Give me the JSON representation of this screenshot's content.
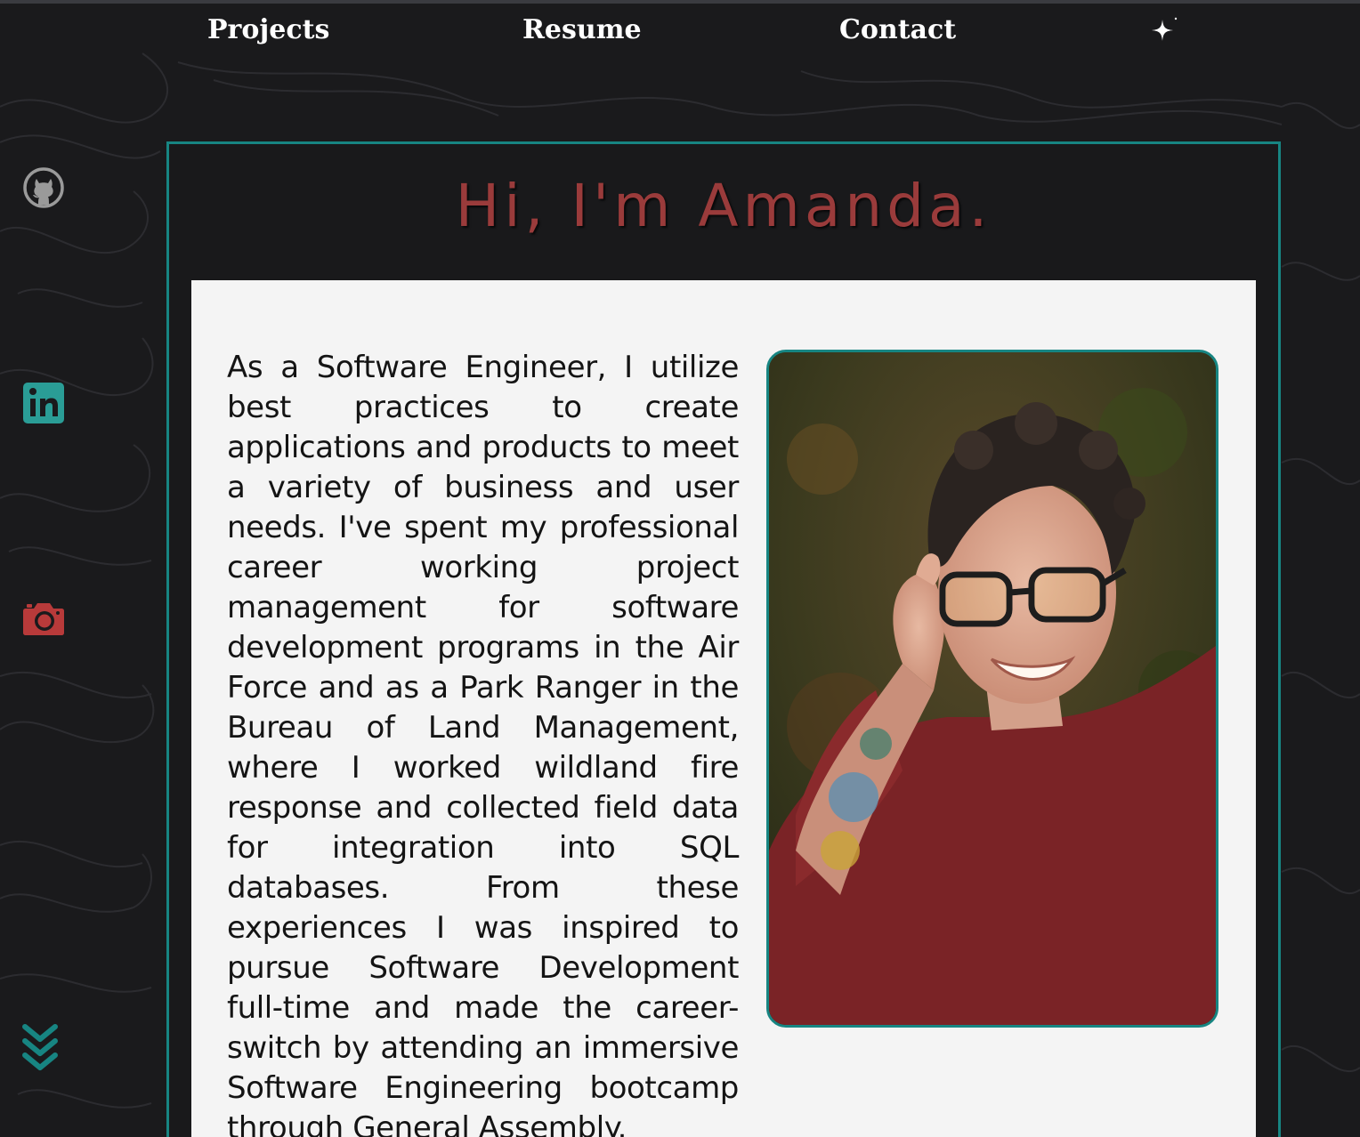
{
  "nav": {
    "links": [
      {
        "label": "Projects"
      },
      {
        "label": "Resume"
      },
      {
        "label": "Contact"
      }
    ],
    "theme_toggle_icon": "sparkle-icon"
  },
  "social": {
    "icons": [
      "github-icon",
      "linkedin-icon",
      "camera-icon"
    ],
    "scroll_icon": "double-chevron-down-icon"
  },
  "hero": {
    "greeting": "Hi, I'm Amanda.",
    "bio": "As a Software Engineer, I utilize best practices to create applications and products to meet a variety of business and user needs. I've spent my professional career working project management for software development programs in the Air Force and as a Park Ranger in the Bureau of Land Management, where I worked wildland fire response and collected field data for integration into SQL databases. From these experiences I was inspired to pursue Software Development full-time and made the career-switch by attending an immersive Software Engineering bootcamp through General Assembly."
  },
  "colors": {
    "background": "#1a1a1c",
    "accent_teal": "#178582",
    "greeting_red": "#9a3b3b",
    "card_background": "#f4f4f4",
    "camera_icon": "#b83a3a",
    "github_icon": "#9a9a9a"
  }
}
